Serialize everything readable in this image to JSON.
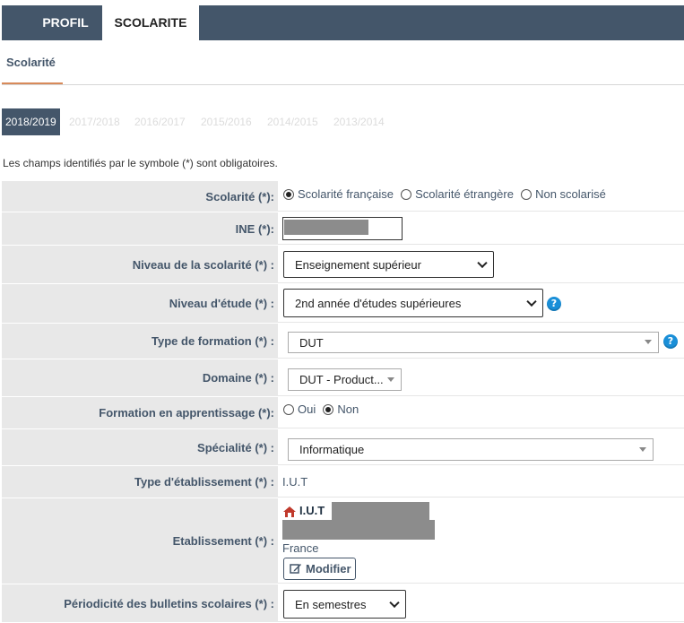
{
  "top_tabs": {
    "profil": "PROFIL",
    "scolarite": "SCOLARITE"
  },
  "sub_tab": "Scolarité",
  "years": [
    "2018/2019",
    "2017/2018",
    "2016/2017",
    "2015/2016",
    "2014/2015",
    "2013/2014"
  ],
  "notice": "Les champs identifiés par le symbole (*) sont obligatoires.",
  "form": {
    "scolarite": {
      "label": "Scolarité (*):",
      "options": [
        "Scolarité française",
        "Scolarité étrangère",
        "Non scolarisé"
      ],
      "selected": "Scolarité française"
    },
    "ine": {
      "label": "INE (*):"
    },
    "niveau_scolarite": {
      "label": "Niveau de la scolarité (*) :",
      "value": "Enseignement supérieur"
    },
    "niveau_etude": {
      "label": "Niveau d'étude (*) :",
      "value": "2nd année d'études supérieures"
    },
    "type_formation": {
      "label": "Type de formation (*) :",
      "value": "DUT"
    },
    "domaine": {
      "label": "Domaine (*) :",
      "value": "DUT - Product..."
    },
    "apprentissage": {
      "label": "Formation en apprentissage (*):",
      "options": [
        "Oui",
        "Non"
      ],
      "selected": "Non"
    },
    "specialite": {
      "label": "Spécialité (*) :",
      "value": "Informatique"
    },
    "type_etablissement": {
      "label": "Type d'établissement (*) :",
      "value": "I.U.T"
    },
    "etablissement": {
      "label": "Etablissement (*) :",
      "name": "I.U.T",
      "country": "France",
      "button": "Modifier"
    },
    "periodicite": {
      "label": "Périodicité des bulletins scolaires (*) :",
      "value": "En semestres"
    }
  },
  "icons": {
    "help": "help-icon",
    "home": "home-icon",
    "edit": "edit-icon"
  },
  "colors": {
    "header": "#44566a",
    "accent": "#d88a5a",
    "label_bg": "#e8e8e8",
    "help": "#1a8fd8"
  }
}
